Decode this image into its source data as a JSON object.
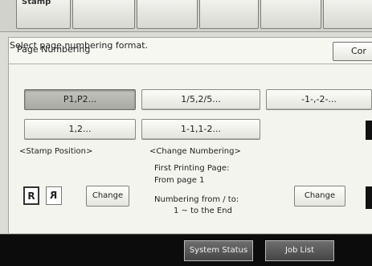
{
  "title_bar": {
    "title": "Page Numbering",
    "confirm_label": "Cor"
  },
  "top_tabs": [
    "Stamp",
    "",
    "",
    "",
    "",
    ""
  ],
  "instruction": "Select page numbering format.",
  "formats": [
    {
      "label": "P1,P2...",
      "selected": true
    },
    {
      "label": "1/5,2/5...",
      "selected": false
    },
    {
      "label": "-1-,-2-...",
      "selected": false
    },
    {
      "label": "1,2...",
      "selected": false
    },
    {
      "label": "1-1,1-2...",
      "selected": false
    }
  ],
  "stamp_position": {
    "label": "<Stamp Position>",
    "icon_left": "R",
    "icon_right": "R",
    "change_label": "Change"
  },
  "change_numbering": {
    "label": "<Change Numbering>",
    "first_printing_page_label": "First Printing Page:",
    "from_page": "From page  1",
    "numbering_label": "Numbering from / to:",
    "numbering_value": "1        ~  to the End",
    "change_label": "Change"
  },
  "bottom_bar": {
    "system_status_label": "System Status",
    "job_list_label": "Job List"
  }
}
